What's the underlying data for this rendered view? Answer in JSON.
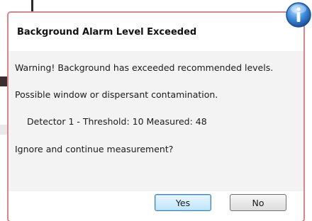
{
  "dialog": {
    "title": "Background Alarm Level Exceeded",
    "icon": "info-icon",
    "messages": {
      "warning": "Warning! Background has exceeded recommended levels.",
      "possible": "Possible window or dispersant contamination.",
      "detector": "Detector 1 - Threshold: 10 Measured: 48",
      "question": "Ignore and continue measurement?"
    },
    "buttons": {
      "yes": "Yes",
      "no": "No"
    },
    "colors": {
      "border": "#d9868a",
      "content_bg": "#f3f3f3",
      "default_button_border": "#3c7fb1"
    }
  }
}
